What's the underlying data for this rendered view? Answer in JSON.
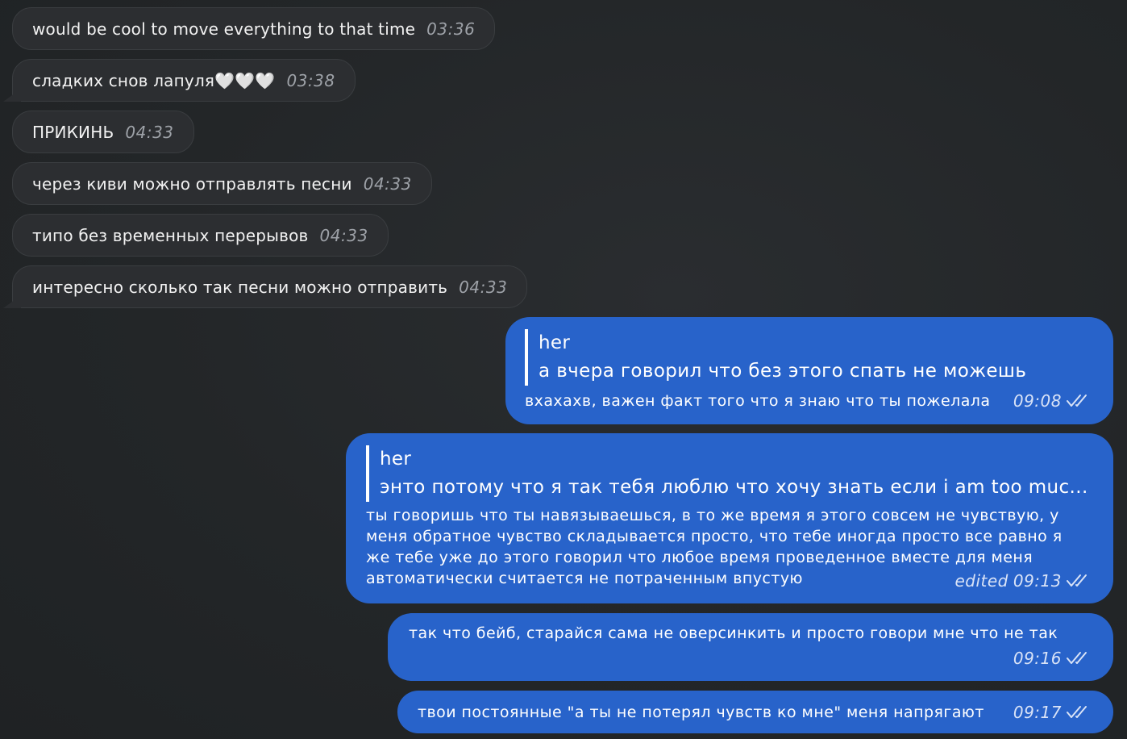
{
  "incoming": [
    {
      "text": "would be cool to move everything to that time",
      "time": "03:36"
    },
    {
      "text": "сладких снов лапуля🤍🤍🤍",
      "time": "03:38"
    },
    {
      "text": "ПРИКИНЬ",
      "time": "04:33"
    },
    {
      "text": "через киви можно отправлять песни",
      "time": "04:33"
    },
    {
      "text": "типо без временных перерывов",
      "time": "04:33"
    },
    {
      "text": "интересно сколько так песни можно отправить",
      "time": "04:33"
    }
  ],
  "outgoing": [
    {
      "reply_author": "her",
      "reply_text": "а вчера говорил что без этого спать не можешь",
      "text": "вхахахв, важен факт того что я знаю что ты пожелала",
      "time": "09:08",
      "status_icon": "double-check-icon"
    },
    {
      "reply_author": "her",
      "reply_text": "энто потому что я так тебя люблю что хочу знать если i am too muc...",
      "text": "ты говоришь что ты навязываешься, в то же время я этого совсем не чувствую, у меня обратное чувство складывается просто, что тебе иногда просто все равно я же тебе уже до этого говорил что любое время проведенное вместе для меня автоматически считается не потраченным впустую",
      "edited_label": "edited",
      "time": "09:13",
      "status_icon": "double-check-icon"
    },
    {
      "text": "так что бейб, старайся сама не оверсинкить и просто говори мне что не так",
      "time": "09:16",
      "status_icon": "double-check-icon"
    },
    {
      "text": "твои постоянные \"а ты не потерял чувств ко мне\" меня напрягают",
      "time": "09:17",
      "status_icon": "double-check-icon"
    }
  ],
  "colors": {
    "background": "#222527",
    "incoming_bubble": "#2c2e31",
    "outgoing_bubble": "#2863ca",
    "timestamp_incoming": "#9ea2a8"
  }
}
